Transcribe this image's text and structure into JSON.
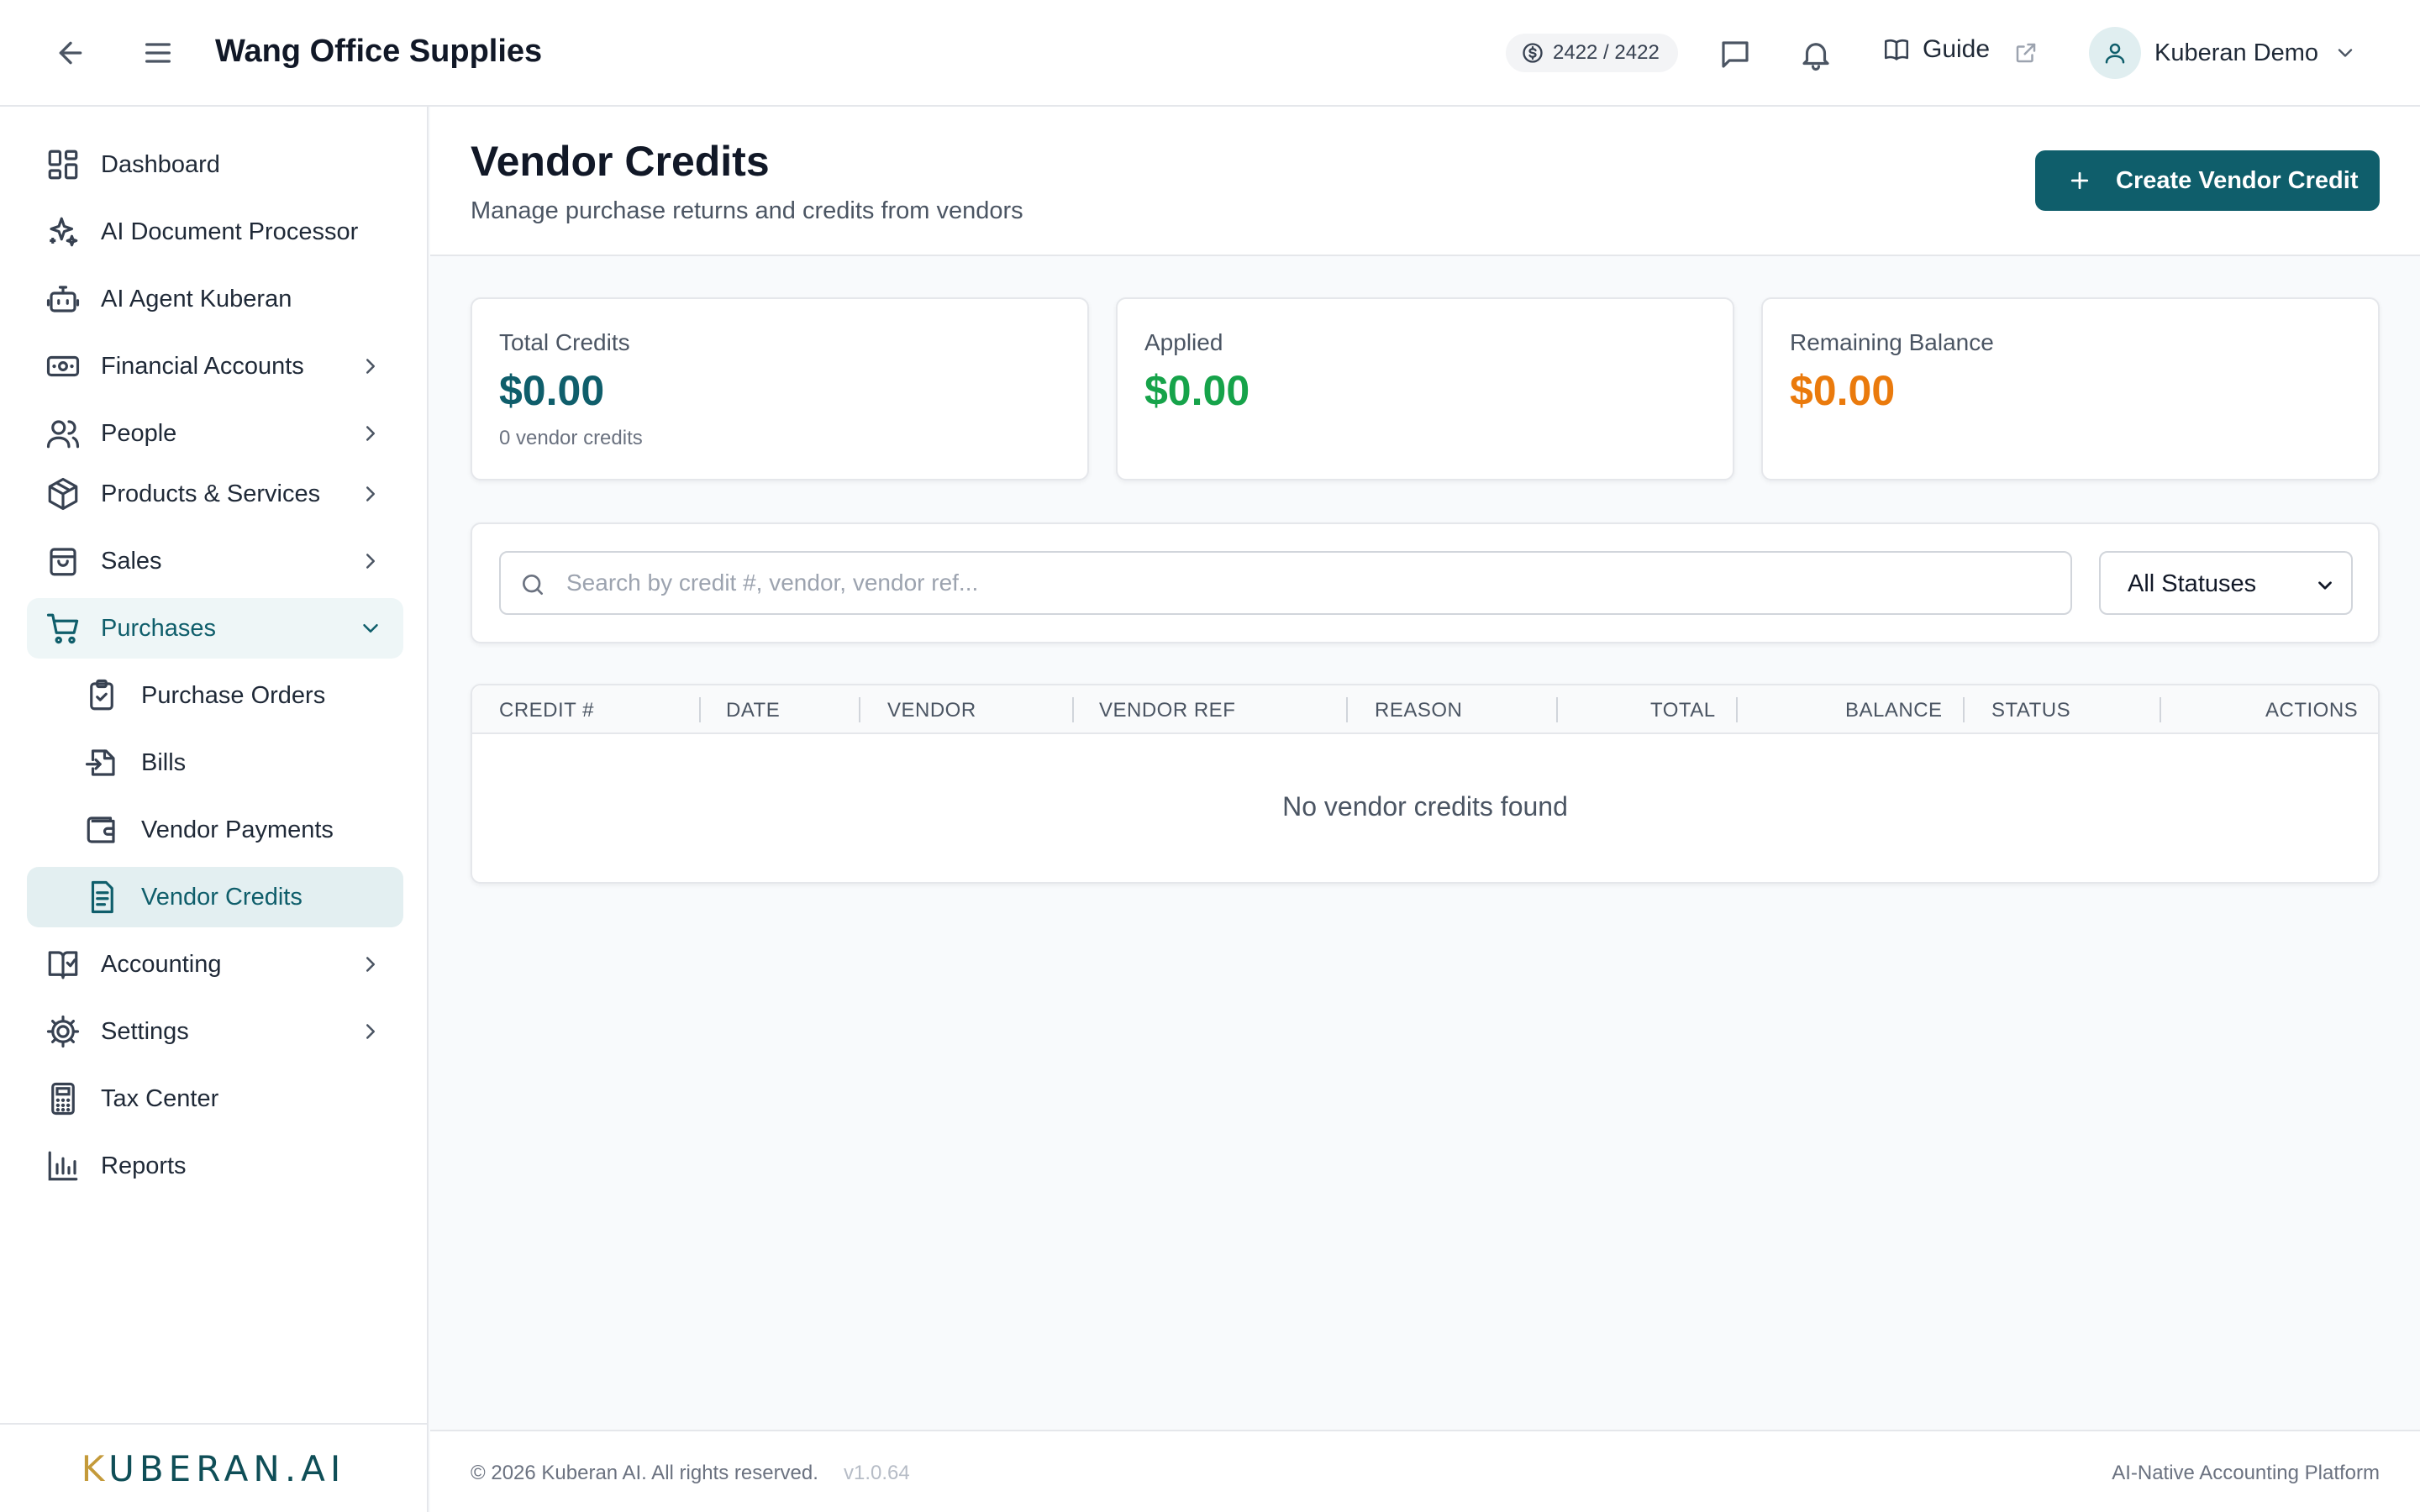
{
  "header": {
    "company": "Wang Office Supplies",
    "credits": "2422 / 2422",
    "guide": "Guide",
    "user_name": "Kuberan Demo",
    "icons": [
      "back-arrow-icon",
      "menu-icon",
      "dollar-coin-icon",
      "chat-icon",
      "bell-icon",
      "book-icon",
      "external-link-icon",
      "user-icon",
      "chevron-down-icon"
    ]
  },
  "sidebar": {
    "items": [
      {
        "label": "Dashboard",
        "icon": "dashboard-icon"
      },
      {
        "label": "AI Document Processor",
        "icon": "sparkles-icon"
      },
      {
        "label": "AI Agent Kuberan",
        "icon": "robot-icon"
      },
      {
        "label": "Financial Accounts",
        "icon": "banknote-icon",
        "expandable": true
      },
      {
        "label": "People",
        "icon": "people-icon",
        "expandable": true
      },
      {
        "label": "Products & Services",
        "icon": "package-icon",
        "expandable": true
      },
      {
        "label": "Sales",
        "icon": "shopping-bag-icon",
        "expandable": true
      },
      {
        "label": "Purchases",
        "icon": "cart-icon",
        "expandable": true,
        "open": true
      },
      {
        "label": "Purchase Orders",
        "icon": "clipboard-check-icon",
        "sub": true
      },
      {
        "label": "Bills",
        "icon": "file-import-icon",
        "sub": true
      },
      {
        "label": "Vendor Payments",
        "icon": "wallet-icon",
        "sub": true
      },
      {
        "label": "Vendor Credits",
        "icon": "receipt-icon",
        "sub": true,
        "active": true
      },
      {
        "label": "Accounting",
        "icon": "book-check-icon",
        "expandable": true
      },
      {
        "label": "Settings",
        "icon": "settings-icon",
        "expandable": true
      },
      {
        "label": "Tax Center",
        "icon": "calculator-icon"
      },
      {
        "label": "Reports",
        "icon": "bar-chart-icon"
      }
    ],
    "logo": {
      "first": "K",
      "rest": "UBERAN.AI"
    }
  },
  "page": {
    "title": "Vendor Credits",
    "subtitle": "Manage purchase returns and credits from vendors",
    "create_button": "Create Vendor Credit"
  },
  "stats": {
    "total_label": "Total Credits",
    "total_value": "$0.00",
    "total_sub": "0 vendor credits",
    "applied_label": "Applied",
    "applied_value": "$0.00",
    "remaining_label": "Remaining Balance",
    "remaining_value": "$0.00",
    "colors": {
      "total": "#0f5e6b",
      "applied": "#16a34a",
      "remaining": "#ea7a0c"
    }
  },
  "filters": {
    "search_placeholder": "Search by credit #, vendor, vendor ref...",
    "search_value": "",
    "status_selected": "All Statuses"
  },
  "table": {
    "columns": [
      "CREDIT #",
      "DATE",
      "VENDOR",
      "VENDOR REF",
      "REASON",
      "TOTAL",
      "BALANCE",
      "STATUS",
      "ACTIONS"
    ],
    "rows": [],
    "empty_text": "No vendor credits found"
  },
  "footer": {
    "copyright": "© 2026 Kuberan AI. All rights reserved.",
    "version": "v1.0.64",
    "tagline": "AI-Native Accounting Platform"
  },
  "colors": {
    "brand": "#0f5e6b",
    "active_bg": "#e3eff1"
  }
}
